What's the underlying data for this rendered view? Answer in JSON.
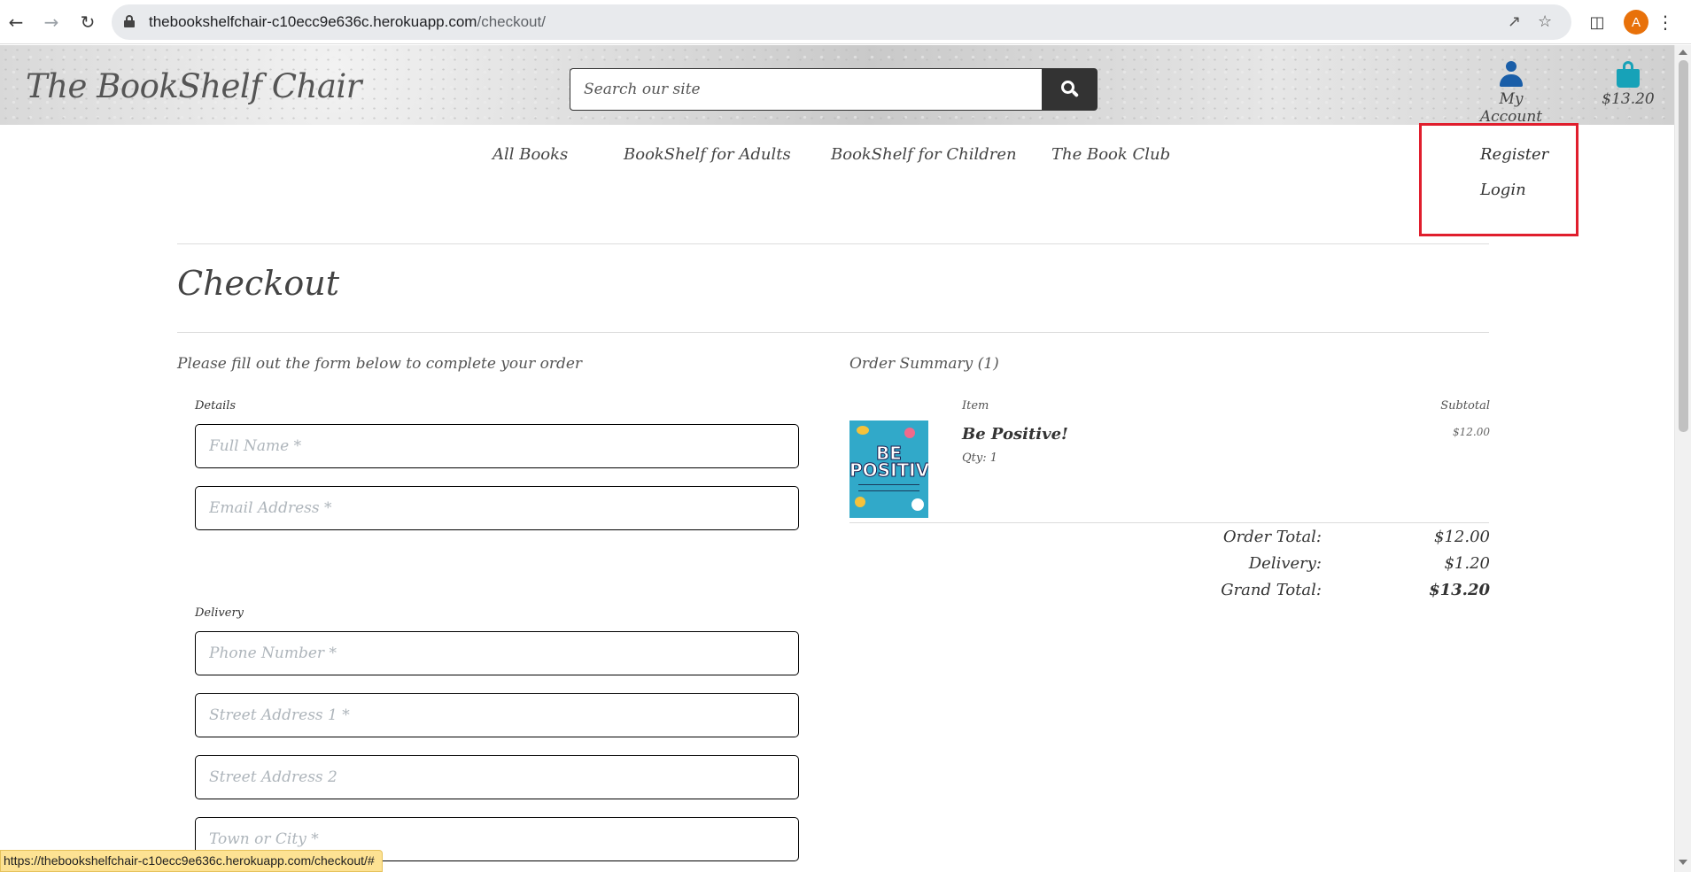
{
  "browser": {
    "url_host": "thebookshelfchair-c10ecc9e636c.herokuapp.com",
    "url_path": "/checkout/",
    "profile_initial": "A",
    "status_url": "https://thebookshelfchair-c10ecc9e636c.herokuapp.com/checkout/#"
  },
  "header": {
    "brand": "The BookShelf Chair",
    "search_placeholder": "Search our site",
    "account_label": "My Account",
    "bag_total": "$13.20"
  },
  "nav": {
    "items": [
      "All Books",
      "BookShelf for Adults",
      "BookShelf for Children",
      "The Book Club"
    ]
  },
  "account_dropdown": {
    "items": [
      "Register",
      "Login"
    ],
    "highlight_color": "#e01e2d"
  },
  "checkout": {
    "title": "Checkout",
    "intro": "Please fill out the form below to complete your order",
    "details_legend": "Details",
    "delivery_legend": "Delivery",
    "details_fields": [
      "Full Name *",
      "Email Address *"
    ],
    "delivery_fields": [
      "Phone Number *",
      "Street Address 1 *",
      "Street Address 2",
      "Town or City *"
    ]
  },
  "summary": {
    "title": "Order Summary (1)",
    "col_item": "Item",
    "col_subtotal": "Subtotal",
    "item": {
      "name": "Be Positive!",
      "qty": "Qty: 1",
      "subtotal": "$12.00",
      "cover_text": "BE POSITIVE!"
    },
    "order_total_label": "Order Total:",
    "order_total": "$12.00",
    "delivery_label": "Delivery:",
    "delivery": "$1.20",
    "grand_total_label": "Grand Total:",
    "grand_total": "$13.20"
  },
  "colors": {
    "account_icon": "#1a5ea8",
    "bag_icon": "#17a2b8",
    "search_button": "#333333"
  }
}
